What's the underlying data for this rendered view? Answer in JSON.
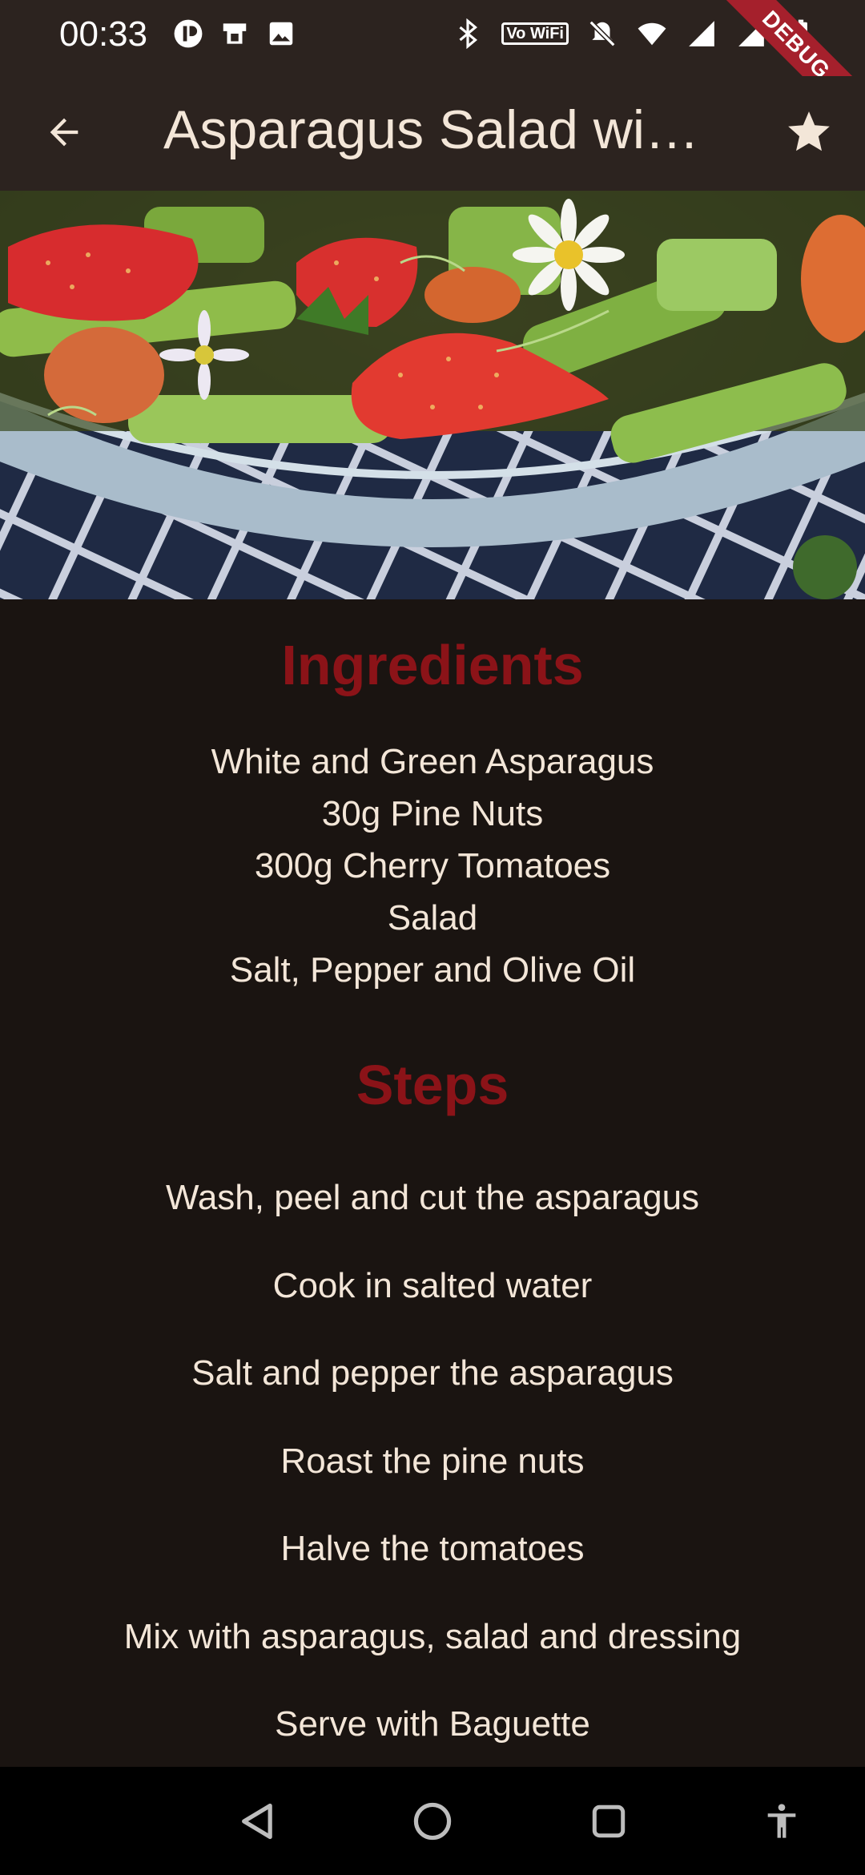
{
  "status_bar": {
    "time": "00:33",
    "left_icons": [
      "pause-icon",
      "sim-icon",
      "image-icon"
    ],
    "right_icons": [
      "bluetooth-icon",
      "vowifi-icon",
      "mute-icon",
      "wifi-icon",
      "signal-icon",
      "signal-roaming-icon",
      "battery-icon"
    ],
    "vowifi_label": "Vo WiFi"
  },
  "debug_banner": {
    "label": "DEBUG"
  },
  "app_bar": {
    "title": "Asparagus Salad with Cherry Tomatoes",
    "back_icon": "arrow-back-icon",
    "favorite_icon": "star-icon"
  },
  "hero": {
    "alt": "asparagus-salad-photo"
  },
  "ingredients": {
    "title": "Ingredients",
    "items": [
      "White and Green Asparagus",
      "30g Pine Nuts",
      "300g Cherry Tomatoes",
      "Salad",
      "Salt, Pepper and Olive Oil"
    ]
  },
  "steps": {
    "title": "Steps",
    "items": [
      "Wash, peel and cut the asparagus",
      "Cook in salted water",
      "Salt and pepper the asparagus",
      "Roast the pine nuts",
      "Halve the tomatoes",
      "Mix with asparagus, salad and dressing",
      "Serve with Baguette"
    ]
  },
  "nav_bar": {
    "buttons": [
      "back-triangle-icon",
      "home-circle-icon",
      "recents-square-icon",
      "accessibility-icon"
    ]
  },
  "colors": {
    "background": "#1a1411",
    "app_bar": "#2c231f",
    "accent_title": "#8b1318",
    "text": "#f3e6d8",
    "debug": "#a5202c"
  }
}
